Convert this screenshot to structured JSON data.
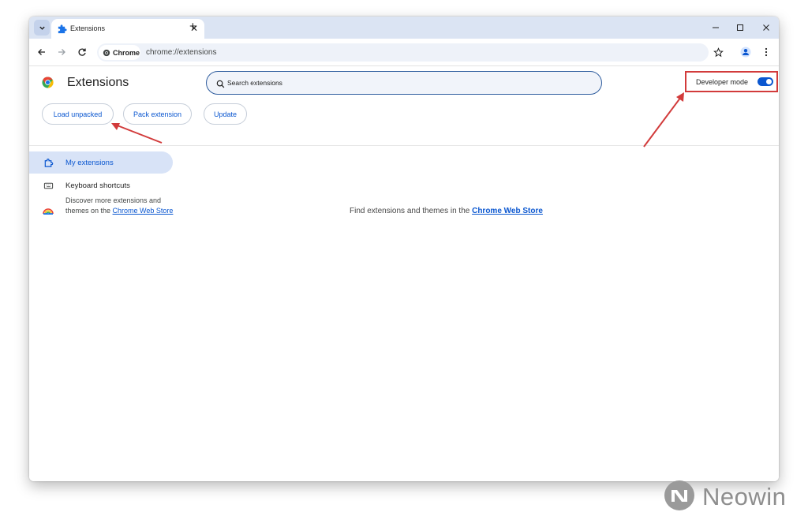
{
  "browser": {
    "tab": {
      "title": "Extensions",
      "close_glyph": "✕"
    },
    "new_tab_glyph": "+",
    "omnibox": {
      "chip_label": "Chrome",
      "url": "chrome://extensions"
    }
  },
  "page": {
    "title": "Extensions",
    "search": {
      "placeholder": "Search extensions"
    },
    "developer_mode": {
      "label": "Developer mode",
      "enabled": true
    },
    "actions": [
      {
        "label": "Load unpacked"
      },
      {
        "label": "Pack extension"
      },
      {
        "label": "Update"
      }
    ],
    "sidebar": {
      "items": [
        {
          "label": "My extensions",
          "icon": "puzzle-icon",
          "selected": true
        },
        {
          "label": "Keyboard shortcuts",
          "icon": "keyboard-icon",
          "selected": false
        }
      ],
      "discover": {
        "prefix": "Discover more extensions and themes on the ",
        "link": "Chrome Web Store"
      }
    },
    "empty_state": {
      "prefix": "Find extensions and themes in the ",
      "link": "Chrome Web Store"
    }
  },
  "annotations": {
    "color": "#d23b3b"
  },
  "watermark": {
    "text": "Neowin"
  },
  "colors": {
    "accent": "#0b57d0",
    "tabstrip": "#dbe4f3",
    "annotation": "#d23b3b"
  }
}
